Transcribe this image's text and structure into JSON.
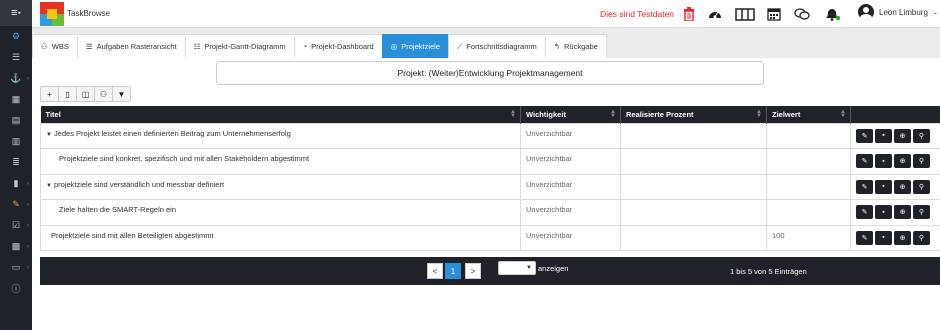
{
  "app": {
    "name": "TaskBrowse",
    "test_notice": "Dies sind Testdaten",
    "user": "Leon Limburg"
  },
  "tabs": [
    {
      "label": "WBS",
      "active": false
    },
    {
      "label": "Aufgaben Rasteransicht",
      "active": false
    },
    {
      "label": "Projekt-Gantt-Diagramm",
      "active": false
    },
    {
      "label": "Projekt-Dashboard",
      "active": false
    },
    {
      "label": "Projektziele",
      "active": true
    },
    {
      "label": "Fortschrittsdiagramm",
      "active": false
    },
    {
      "label": "Rückgabe",
      "active": false
    }
  ],
  "project": {
    "title": "Projekt: (Weiter)Entwicklung Projektmanagement"
  },
  "table": {
    "headers": [
      "Titel",
      "Wichtigkeit",
      "Realisierte Prozent",
      "Zielwert",
      ""
    ],
    "rows": [
      {
        "title": "Jedes Projekt leistet einen definierten Beitrag zum Unternehmenserfolg",
        "importance": "Unverzichtbar",
        "percent": "",
        "target": "",
        "level": 0,
        "expandable": true
      },
      {
        "title": "Projektziele sind konkret, spezifisch und mit allen Stakeholdern abgestimmt",
        "importance": "Unverzichtbar",
        "percent": "",
        "target": "",
        "level": 1,
        "expandable": false
      },
      {
        "title": "projektziele sind verständlich und messbar definiert",
        "importance": "Unverzichtbar",
        "percent": "",
        "target": "",
        "level": 0,
        "expandable": true
      },
      {
        "title": "Ziele halten die SMART-Regeln ein",
        "importance": "Unverzichtbar",
        "percent": "",
        "target": "",
        "level": 1,
        "expandable": false
      },
      {
        "title": "Projektziele sind mit allen Beteiligten abgestimmt",
        "importance": "Unverzichtbar",
        "percent": "",
        "target": "100",
        "level": 0,
        "expandable": false
      }
    ]
  },
  "pagination": {
    "prev": "<",
    "current": "1",
    "next": ">",
    "page_size_label": "anzeigen",
    "info": "1 bis 5 von 5 Einträgen"
  },
  "colors": {
    "accent": "#2a8ed8",
    "dark": "#1f2329",
    "danger": "#e23"
  }
}
